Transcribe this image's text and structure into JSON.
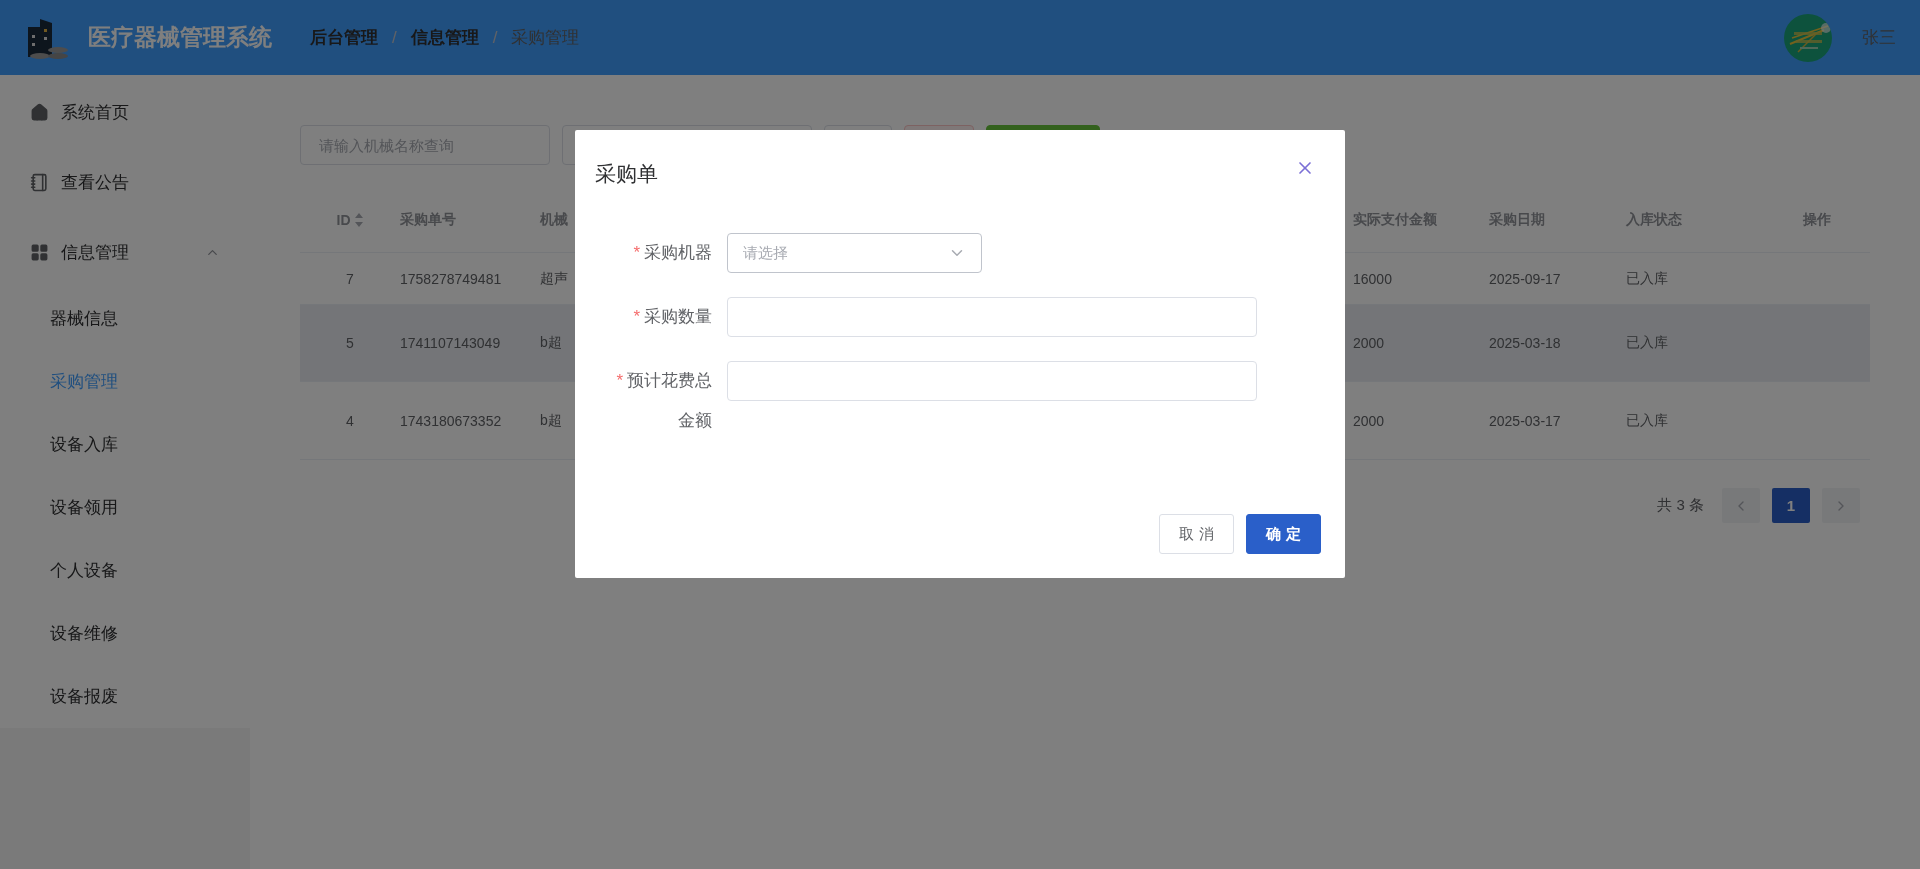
{
  "header": {
    "title": "医疗器械管理系统",
    "separator": "/",
    "breadcrumb": [
      {
        "label": "后台管理",
        "current": false
      },
      {
        "label": "信息管理",
        "current": false
      },
      {
        "label": "采购管理",
        "current": true
      }
    ],
    "user": {
      "name": "张三"
    }
  },
  "sidebar": {
    "items": [
      {
        "label": "系统首页",
        "selected": false
      },
      {
        "label": "查看公告",
        "selected": false
      },
      {
        "label": "信息管理",
        "selected": false,
        "expanded": true,
        "children": [
          {
            "label": "器械信息",
            "selected": false
          },
          {
            "label": "采购管理",
            "selected": true
          },
          {
            "label": "设备入库",
            "selected": false
          },
          {
            "label": "设备领用",
            "selected": false
          },
          {
            "label": "个人设备",
            "selected": false
          },
          {
            "label": "设备维修",
            "selected": false
          },
          {
            "label": "设备报废",
            "selected": false
          }
        ]
      }
    ]
  },
  "search": {
    "placeholder": "请输入机械名称查询"
  },
  "table": {
    "columns": [
      {
        "label": "ID",
        "sortable": true
      },
      {
        "label": "采购单号",
        "sortable": false
      },
      {
        "label": "机械",
        "sortable": false
      },
      {
        "label": "实际支付金额",
        "sortable": false
      },
      {
        "label": "采购日期",
        "sortable": false
      },
      {
        "label": "入库状态",
        "sortable": false
      },
      {
        "label": "操作",
        "sortable": false
      }
    ],
    "rows": [
      {
        "highlighted": false,
        "cells": [
          "7",
          "1758278749481",
          "超声",
          "16000",
          "2025-09-17",
          "已入库"
        ]
      },
      {
        "highlighted": true,
        "cells": [
          "5",
          "1741107143049",
          "b超",
          "2000",
          "2025-03-18",
          "已入库"
        ]
      },
      {
        "highlighted": false,
        "cells": [
          "4",
          "1743180673352",
          "b超",
          "2000",
          "2025-03-17",
          "已入库"
        ]
      }
    ]
  },
  "pagination": {
    "total": "共 3 条",
    "pages": [
      {
        "label": "1",
        "selected": true
      }
    ]
  },
  "dialog": {
    "title": "采购单",
    "required_mark": "*",
    "fields": [
      {
        "kind": "select",
        "label": "采购机器",
        "required": true,
        "placeholder": "请选择"
      },
      {
        "kind": "input",
        "label": "采购数量",
        "required": true
      },
      {
        "kind": "input",
        "label": "预计花费总金额",
        "required": true
      }
    ],
    "buttons": [
      {
        "label": "取 消",
        "kind": "default"
      },
      {
        "label": "确 定",
        "kind": "primary"
      }
    ]
  }
}
